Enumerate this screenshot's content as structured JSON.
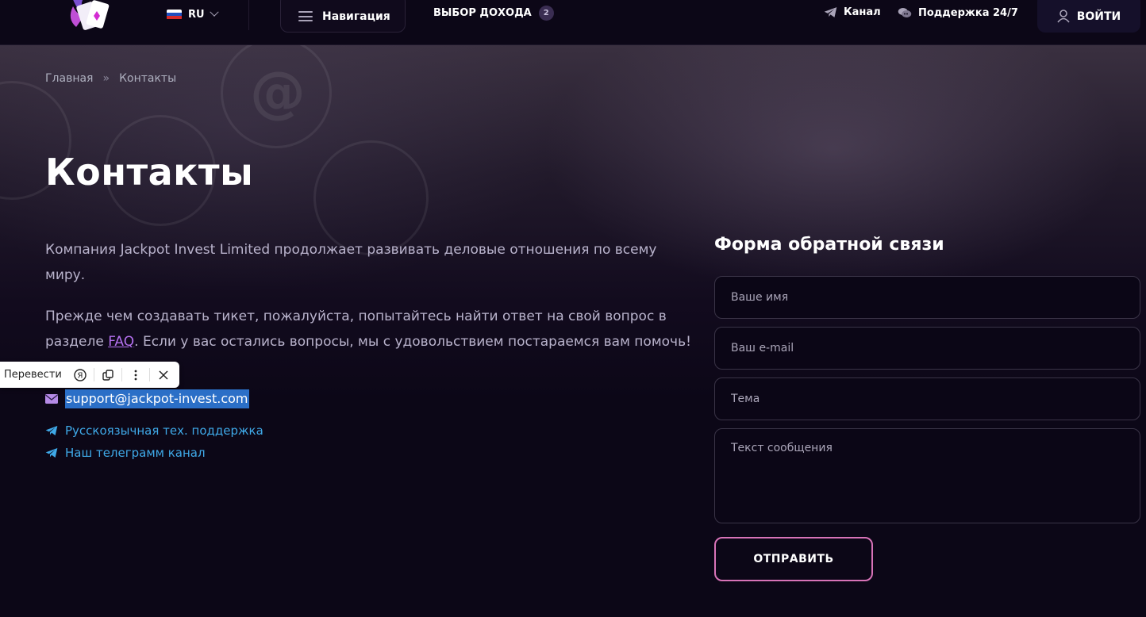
{
  "header": {
    "language": "RU",
    "nav_label": "Навигация",
    "income_label": "ВЫБОР ДОХОДА",
    "income_count": "2",
    "channel_label": "Канал",
    "support_label": "Поддержка 24/7",
    "login_label": "ВОЙТИ"
  },
  "breadcrumb": {
    "home": "Главная",
    "separator": "»",
    "current": "Контакты"
  },
  "page_title": "Контакты",
  "intro": {
    "paragraph1": "Компания Jackpot Invest Limited продолжает развивать деловые отношения по всему миру.",
    "paragraph2_before": "Прежде чем создавать тикет, пожалуйста, попытайтесь найти ответ на свой вопрос в разделе ",
    "faq_link": "FAQ",
    "paragraph2_after": ". Если у вас остались вопросы, мы с удовольствием постараемся вам помочь!"
  },
  "translate_popup": {
    "label": "Перевести",
    "yandex_glyph": "Я"
  },
  "contacts": {
    "email": "support@jackpot-invest.com",
    "tech_support": "Русскоязычная тех. поддержка",
    "telegram_channel": "Наш телеграмм канал"
  },
  "form": {
    "title": "Форма обратной связи",
    "name_placeholder": "Ваше имя",
    "email_placeholder": "Ваш e-mail",
    "subject_placeholder": "Тема",
    "message_placeholder": "Текст сообщения",
    "submit_label": "ОТПРАВИТЬ"
  },
  "colors": {
    "background": "#0c0717",
    "accent_pink": "#d873b8",
    "link_purple": "#b571f0",
    "telegram_blue": "#3fa9e8",
    "selection_blue": "#2b6fc7"
  },
  "icons": {
    "logo": "playing-cards-logo",
    "flag": "russia-flag-icon",
    "channel": "telegram-icon",
    "support": "chat-bubbles-icon",
    "login": "user-icon",
    "email": "envelope-icon"
  }
}
